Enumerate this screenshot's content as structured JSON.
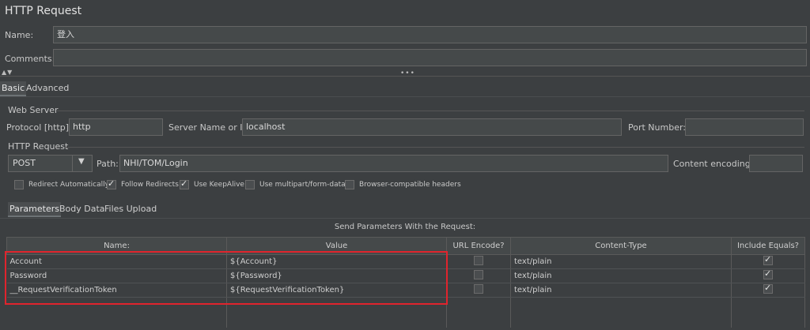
{
  "panel_title": "HTTP Request",
  "name": {
    "label": "Name:",
    "value": "登入"
  },
  "comments": {
    "label": "Comments:",
    "value": ""
  },
  "tabs": [
    {
      "label": "Basic",
      "active": true
    },
    {
      "label": "Advanced",
      "active": false
    }
  ],
  "web_server": {
    "title": "Web Server",
    "protocol_label": "Protocol [http]:",
    "protocol_value": "http",
    "server_label": "Server Name or IP:",
    "server_value": "localhost",
    "port_label": "Port Number:",
    "port_value": ""
  },
  "http_request": {
    "title": "HTTP Request",
    "method": "POST",
    "path_label": "Path:",
    "path_value": "NHI/TOM/Login",
    "encoding_label": "Content encoding:",
    "encoding_value": ""
  },
  "options": [
    {
      "label": "Redirect Automatically",
      "checked": false
    },
    {
      "label": "Follow Redirects",
      "checked": true
    },
    {
      "label": "Use KeepAlive",
      "checked": true
    },
    {
      "label": "Use multipart/form-data",
      "checked": false
    },
    {
      "label": "Browser-compatible headers",
      "checked": false
    }
  ],
  "sub_tabs": [
    {
      "label": "Parameters",
      "active": true
    },
    {
      "label": "Body Data",
      "active": false
    },
    {
      "label": "Files Upload",
      "active": false
    }
  ],
  "params_caption": "Send Parameters With the Request:",
  "columns": [
    "Name:",
    "Value",
    "URL Encode?",
    "Content-Type",
    "Include Equals?"
  ],
  "rows": [
    {
      "name": "Account",
      "value": "${Account}",
      "url_encode": false,
      "content_type": "text/plain",
      "include_equals": true
    },
    {
      "name": "Password",
      "value": "${Password}",
      "url_encode": false,
      "content_type": "text/plain",
      "include_equals": true
    },
    {
      "name": "__RequestVerificationToken",
      "value": "${RequestVerificationToken}",
      "url_encode": false,
      "content_type": "text/plain",
      "include_equals": true
    }
  ],
  "colors": {
    "background": "#3c3f41",
    "field": "#45494a",
    "highlight": "#e0242d"
  }
}
